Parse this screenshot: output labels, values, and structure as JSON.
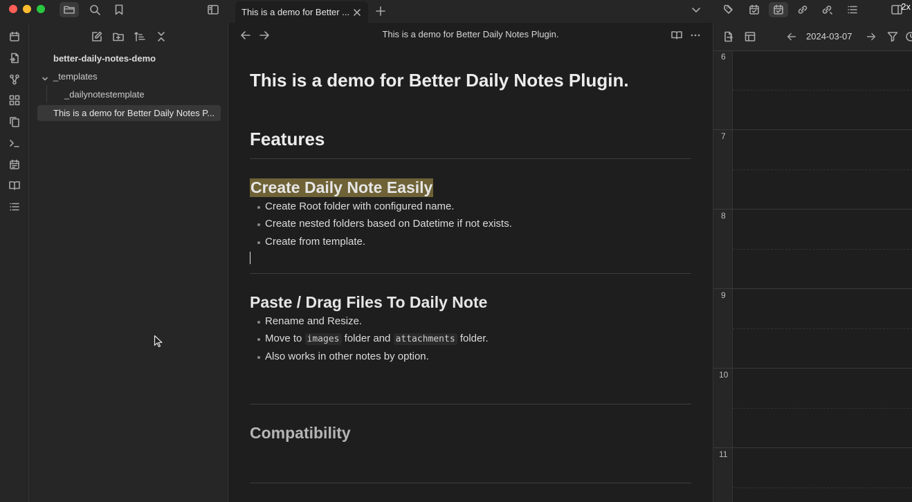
{
  "window": {
    "tab_title": "This is a demo for Better ...",
    "zoom_badge": "2x"
  },
  "sidebar": {
    "vault_name": "better-daily-notes-demo",
    "tree": [
      {
        "label": "_templates"
      },
      {
        "label": "_dailynotestemplate"
      },
      {
        "label": "This is a demo for Better Daily Notes P..."
      }
    ]
  },
  "editor": {
    "header_title": "This is a demo for Better Daily Notes Plugin.",
    "title": "This is a demo for Better Daily Notes Plugin.",
    "features_heading": "Features",
    "section_create": {
      "heading": "Create Daily Note Easily",
      "bullets": [
        "Create Root folder with configured name.",
        "Create nested folders based on Datetime if not exists.",
        "Create from template."
      ]
    },
    "section_paste": {
      "heading": "Paste / Drag Files To Daily Note",
      "bullet_1": "Rename and Resize.",
      "bullet_2": {
        "prefix": "Move to",
        "code_1": "images",
        "mid": "folder and",
        "code_2": "attachments",
        "suffix": "folder."
      },
      "bullet_3": "Also works in other notes by option."
    },
    "compat_heading": "Compatibility"
  },
  "calendar_panel": {
    "date": "2024-03-07",
    "hours": [
      "6",
      "7",
      "8",
      "9",
      "10",
      "11"
    ]
  },
  "icons": {
    "ribbon": [
      "calendar-icon",
      "file-import-icon",
      "graph-icon",
      "blocks-icon",
      "copy-icon",
      "terminal-icon",
      "calendar-days-icon",
      "book-open-icon",
      "list-icon"
    ]
  },
  "colors": {
    "highlight": "#6e6236",
    "background": "#1e1e1e",
    "panel": "#262626"
  }
}
